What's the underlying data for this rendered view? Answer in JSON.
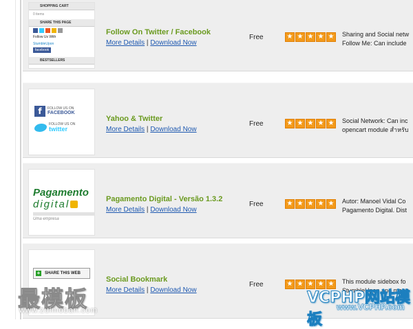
{
  "extensions": [
    {
      "title": "Follow On Twitter / Facebook",
      "details_label": "More Details",
      "separator": "|",
      "download_label": "Download Now",
      "price": "Free",
      "rating": 5,
      "description_lines": [
        "Sharing and Social netw",
        "Follow Me: Can include"
      ],
      "thumbnail": {
        "kind": "shopping-cart-module",
        "lines": [
          "SHOPPING CART",
          "0 items",
          "SHARE THIS PAGE",
          "Follow Us With",
          "StumbleUpon",
          "facebook",
          "BESTSELLERS"
        ]
      }
    },
    {
      "title": "Yahoo & Twitter",
      "details_label": "More Details",
      "separator": "|",
      "download_label": "Download Now",
      "price": "Free",
      "rating": 5,
      "description_lines": [
        "Social Network: Can inc",
        "opencart module สำหรับ"
      ],
      "thumbnail": {
        "kind": "follow-badges",
        "lines": [
          "FOLLOW US ON",
          "FACEBOOK",
          "FOLLOW US ON",
          "twitter"
        ]
      }
    },
    {
      "title": "Pagamento Digital - Versão 1.3.2",
      "details_label": "More Details",
      "separator": "|",
      "download_label": "Download Now",
      "price": "Free",
      "rating": 5,
      "description_lines": [
        "Autor: Manoel Vidal Co",
        "Pagamento Digital. Dist"
      ],
      "thumbnail": {
        "kind": "logo",
        "lines": [
          "Pagamento",
          "digital",
          "Uma empresa"
        ]
      }
    },
    {
      "title": "Social Bookmark",
      "details_label": "More Details",
      "separator": "|",
      "download_label": "Download Now",
      "price": "Free",
      "rating": 5,
      "description_lines": [
        "This module sidebox fo",
        "StumbleUpon and many"
      ],
      "thumbnail": {
        "kind": "share-box",
        "lines": [
          "SHARE THIS WEB"
        ]
      }
    }
  ],
  "watermarks": {
    "left_title": "最模板",
    "left_url": "www.zuimoban.com",
    "right_title": "VCPHP网站模板",
    "right_url": "www.VCPHP.com"
  },
  "colors": {
    "title_green": "#6a9a1f",
    "link_blue": "#1d58b0",
    "star_orange": "#f39a1b",
    "row_bg": "#eeeeee"
  }
}
